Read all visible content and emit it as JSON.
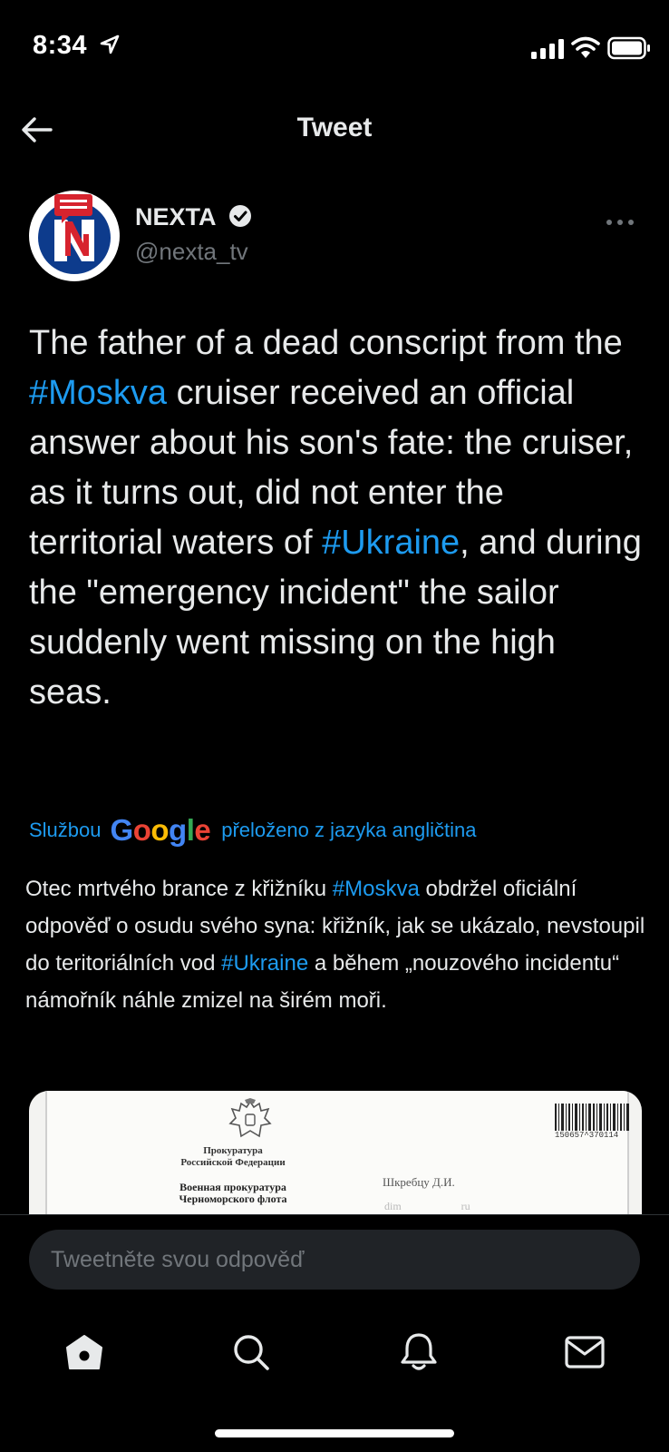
{
  "status_bar": {
    "time": "8:34"
  },
  "header": {
    "title": "Tweet"
  },
  "author": {
    "name": "NEXTA",
    "handle": "@nexta_tv"
  },
  "tweet": {
    "segments": [
      "The father of a dead conscript from the ",
      "#Moskva",
      " cruiser received an official answer about his son's fate: the cruiser, as it turns out, did not enter the territorial waters of ",
      "#Ukraine",
      ", and during the \"emergency incident\" the sailor suddenly went missing on the high seas."
    ]
  },
  "translation": {
    "prefix": "Službou",
    "logo": "Google",
    "suffix": "přeloženo z jazyka angličtina",
    "segments": [
      "Otec mrtvého brance z křižníku ",
      "#Moskva",
      " obdržel oficiální odpověď o osudu svého syna: křižník, jak se ukázalo, nevstoupil do teritoriálních vod ",
      "#Ukraine",
      " a během „nouzového incidentu“ námořník náhle zmizel na širém moři."
    ]
  },
  "media": {
    "doc_org": "Прокуратура\nРоссийской Федерации",
    "doc_dept": "Военная прокуратура\nЧерноморского флота",
    "doc_recipient": "Шкребцу Д.И.",
    "doc_email": "dim                      ru",
    "barcode_number": "150657^370114"
  },
  "reply": {
    "placeholder": "Tweetněte svou odpověď"
  },
  "nav": {
    "items": [
      "home",
      "search",
      "notifications",
      "messages"
    ]
  },
  "colors": {
    "background": "#000000",
    "text": "#e7e9ea",
    "secondary_text": "#71767b",
    "accent": "#1d9bf0",
    "input_background": "#202327"
  }
}
